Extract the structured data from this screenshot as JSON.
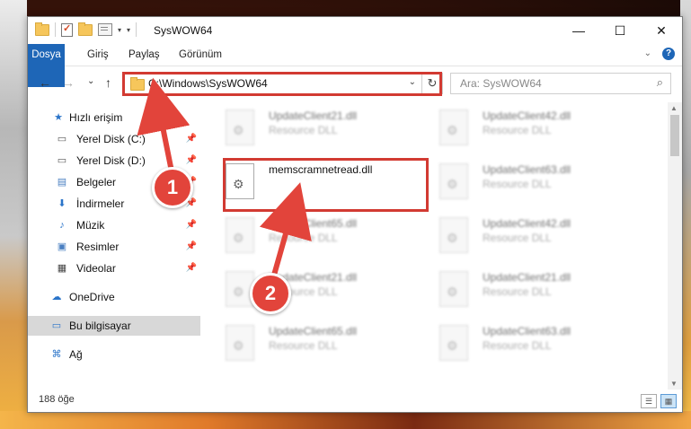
{
  "window": {
    "title": "SysWOW64",
    "minimize": "—",
    "maximize": "☐",
    "close": "✕"
  },
  "ribbon": {
    "tabs": [
      "Dosya",
      "Giriş",
      "Paylaş",
      "Görünüm"
    ]
  },
  "nav": {
    "back": "←",
    "forward": "→",
    "recent": "⌄",
    "up": "↑",
    "address": "C:\\Windows\\SysWOW64",
    "refresh": "↻",
    "search_placeholder": "Ara: SysWOW64"
  },
  "sidebar": {
    "items": [
      {
        "label": "Hızlı erişim",
        "icon": "star-icon",
        "pinned": false
      },
      {
        "label": "Yerel Disk (C:)",
        "icon": "drive-icon",
        "pinned": true
      },
      {
        "label": "Yerel Disk (D:)",
        "icon": "drive-icon",
        "pinned": true
      },
      {
        "label": "Belgeler",
        "icon": "documents-icon",
        "pinned": true
      },
      {
        "label": "İndirmeler",
        "icon": "download-icon",
        "pinned": true
      },
      {
        "label": "Müzik",
        "icon": "music-icon",
        "pinned": true
      },
      {
        "label": "Resimler",
        "icon": "pictures-icon",
        "pinned": true
      },
      {
        "label": "Videolar",
        "icon": "videos-icon",
        "pinned": true
      },
      {
        "label": "OneDrive",
        "icon": "cloud-icon",
        "pinned": false
      },
      {
        "label": "Bu bilgisayar",
        "icon": "computer-icon",
        "pinned": false
      },
      {
        "label": "Ağ",
        "icon": "network-icon",
        "pinned": false
      }
    ]
  },
  "files": [
    {
      "name": "UpdateClient21.dll",
      "type": "Resource DLL"
    },
    {
      "name": "UpdateClient42.dll",
      "type": "Resource DLL"
    },
    {
      "name": "memscramnetread.dll",
      "type": ""
    },
    {
      "name": "UpdateClient63.dll",
      "type": "Resource DLL"
    },
    {
      "name": "UpdateClient65.dll",
      "type": "Resource DLL"
    },
    {
      "name": "UpdateClient42.dll",
      "type": "Resource DLL"
    },
    {
      "name": "UpdateClient21.dll",
      "type": "Resource DLL"
    },
    {
      "name": "UpdateClient21.dll",
      "type": "Resource DLL"
    },
    {
      "name": "UpdateClient65.dll",
      "type": "Resource DLL"
    },
    {
      "name": "UpdateClient63.dll",
      "type": "Resource DLL"
    }
  ],
  "status": {
    "item_count": "188 öğe"
  },
  "callouts": [
    "1",
    "2"
  ],
  "colors": {
    "accent": "#1e66b7",
    "highlight": "#d23a32",
    "callout": "#e2443b"
  }
}
